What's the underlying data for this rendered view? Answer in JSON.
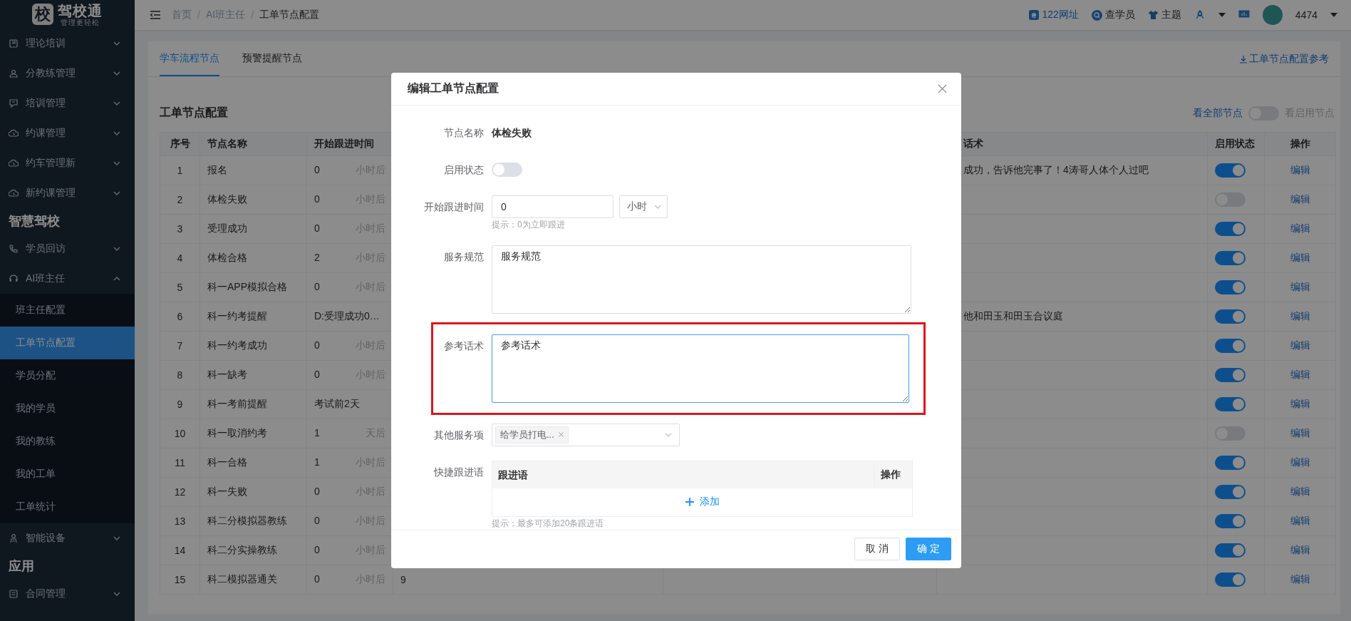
{
  "sidebar": {
    "logo": {
      "badge": "校",
      "title": "驾校通",
      "subtitle": "管理更轻松"
    },
    "items": [
      {
        "kind": "menu",
        "label": "理论培训",
        "expanded": false
      },
      {
        "kind": "menu",
        "label": "分教练管理",
        "expanded": false
      },
      {
        "kind": "menu",
        "label": "培训管理",
        "expanded": false
      },
      {
        "kind": "menu",
        "label": "约课管理",
        "expanded": false
      },
      {
        "kind": "menu",
        "label": "约车管理新",
        "expanded": false
      },
      {
        "kind": "menu",
        "label": "新约课管理",
        "expanded": false
      },
      {
        "kind": "group",
        "label": "智慧驾校"
      },
      {
        "kind": "menu",
        "label": "学员回访",
        "expanded": false
      },
      {
        "kind": "menu",
        "label": "AI班主任",
        "expanded": true,
        "children": [
          {
            "label": "班主任配置",
            "selected": false
          },
          {
            "label": "工单节点配置",
            "selected": true
          },
          {
            "label": "学员分配",
            "selected": false
          },
          {
            "label": "我的学员",
            "selected": false
          },
          {
            "label": "我的教练",
            "selected": false
          },
          {
            "label": "我的工单",
            "selected": false
          },
          {
            "label": "工单统计",
            "selected": false
          }
        ]
      },
      {
        "kind": "menu",
        "label": "智能设备",
        "expanded": false
      },
      {
        "kind": "group",
        "label": "应用"
      },
      {
        "kind": "menu",
        "label": "合同管理",
        "expanded": false
      }
    ]
  },
  "topbar": {
    "breadcrumb": [
      "首页",
      "AI班主任",
      "工单节点配置"
    ],
    "separator": "/",
    "links": [
      "122网址",
      "查学员",
      "主题"
    ],
    "user": "4474"
  },
  "tabs": [
    {
      "label": "学车流程节点",
      "selected": true
    },
    {
      "label": "预警提醒节点",
      "selected": false
    }
  ],
  "reference_link": "工单节点配置参考",
  "section_title": "工单节点配置",
  "view_filter": {
    "left_label": "看全部节点",
    "right_label": "看启用节点",
    "on": false
  },
  "table": {
    "columns": [
      "序号",
      "节点名称",
      "开始跟进时间",
      "",
      "",
      "话术",
      "启用状态",
      "操作"
    ],
    "rows": [
      {
        "no": "1",
        "name": "报名",
        "start": "0",
        "unit": "小时后",
        "script": "成功，告诉他完事了！4涛哥人体个人过吧",
        "enabled": true,
        "action": "编辑"
      },
      {
        "no": "2",
        "name": "体检失败",
        "start": "0",
        "unit": "小时后",
        "enabled": false,
        "action": "编辑"
      },
      {
        "no": "3",
        "name": "受理成功",
        "start": "0",
        "unit": "小时后",
        "enabled": true,
        "action": "编辑"
      },
      {
        "no": "4",
        "name": "体检合格",
        "start": "2",
        "unit": "小时后",
        "enabled": true,
        "action": "编辑"
      },
      {
        "no": "5",
        "name": "科一APP模拟合格",
        "start": "0",
        "unit": "小时后",
        "enabled": true,
        "action": "编辑"
      },
      {
        "no": "6",
        "name": "科一约考提醒",
        "start": "D:受理成功0…",
        "script": "他和田玉和田玉合议庭",
        "enabled": true,
        "action": "编辑"
      },
      {
        "no": "7",
        "name": "科一约考成功",
        "start": "0",
        "unit": "小时后",
        "enabled": true,
        "action": "编辑"
      },
      {
        "no": "8",
        "name": "科一缺考",
        "start": "0",
        "unit": "小时后",
        "enabled": true,
        "action": "编辑"
      },
      {
        "no": "9",
        "name": "科一考前提醒",
        "start": "考试前2天",
        "enabled": true,
        "action": "编辑"
      },
      {
        "no": "10",
        "name": "科一取消约考",
        "start": "1",
        "unit": "天后",
        "enabled": false,
        "action": "编辑"
      },
      {
        "no": "11",
        "name": "科一合格",
        "start": "1",
        "unit": "小时后",
        "enabled": true,
        "action": "编辑"
      },
      {
        "no": "12",
        "name": "科一失败",
        "start": "0",
        "unit": "小时后",
        "enabled": true,
        "action": "编辑"
      },
      {
        "no": "13",
        "name": "科二分模拟器教练",
        "start": "0",
        "unit": "小时后",
        "enabled": true,
        "action": "编辑"
      },
      {
        "no": "14",
        "name": "科二分实操教练",
        "start": "0",
        "unit": "小时后",
        "enabled": true,
        "action": "编辑"
      },
      {
        "no": "15",
        "name": "科二模拟器通关",
        "start": "0",
        "unit": "小时后",
        "column_4": "9",
        "enabled": true,
        "action": "编辑"
      }
    ]
  },
  "dialog": {
    "title": "编辑工单节点配置",
    "node_name": {
      "label": "节点名称",
      "value": "体检失败"
    },
    "status": {
      "label": "启用状态",
      "on": false
    },
    "start_time": {
      "label": "开始跟进时间",
      "value": "0",
      "unit": "小时",
      "hint": "提示：0为立即跟进"
    },
    "service_standard": {
      "label": "服务规范",
      "value": "服务规范"
    },
    "reference_script": {
      "label": "参考话术",
      "value": "参考话术",
      "highlighted": true
    },
    "other_services": {
      "label": "其他服务项",
      "tags": [
        "给学员打电..."
      ]
    },
    "quick_replies": {
      "label": "快捷跟进语",
      "columns": [
        "跟进语",
        "操作"
      ],
      "add": "添加",
      "hint": "提示：最多可添加20条跟进语"
    },
    "buttons": [
      "取 消",
      "确 定"
    ]
  }
}
